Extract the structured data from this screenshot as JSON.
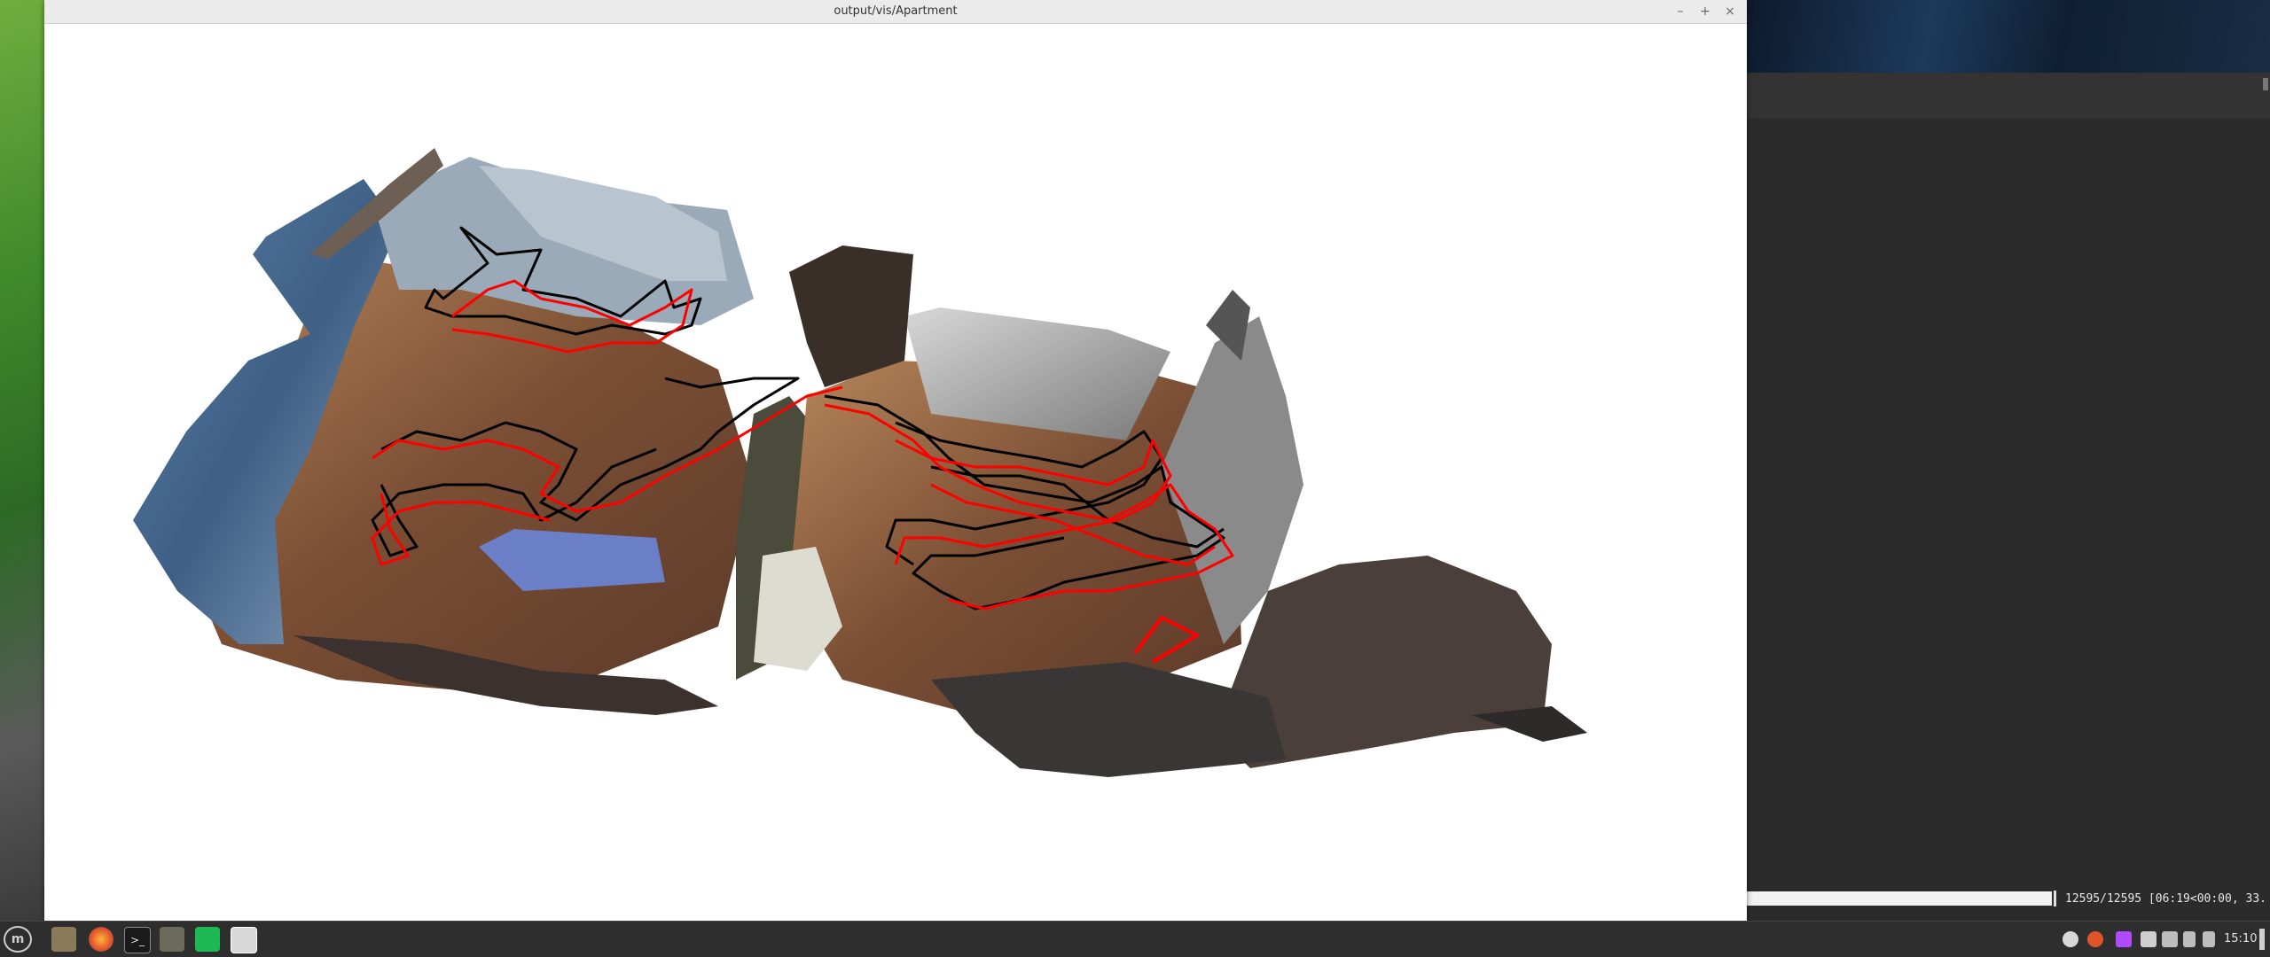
{
  "window": {
    "title": "output/vis/Apartment"
  },
  "terminal": {
    "progress_text": "12595/12595 [06:19<00:00, 33.",
    "progress": 1.0
  },
  "taskbar": {
    "clock": "15:10",
    "launchers": [
      "menu-icon",
      "files-icon",
      "firefox-icon",
      "terminal-icon",
      "gimp-icon",
      "spotify-icon",
      "image-viewer-icon"
    ],
    "tray_icons": [
      "discord-icon",
      "firefox-icon",
      "app-icon",
      "shield-icon",
      "printer-icon",
      "network-icon",
      "audio-icon"
    ]
  },
  "colors": {
    "trajectory_estimated": "#ff0000",
    "trajectory_groundtruth": "#000000",
    "canvas_background": "#ffffff"
  }
}
